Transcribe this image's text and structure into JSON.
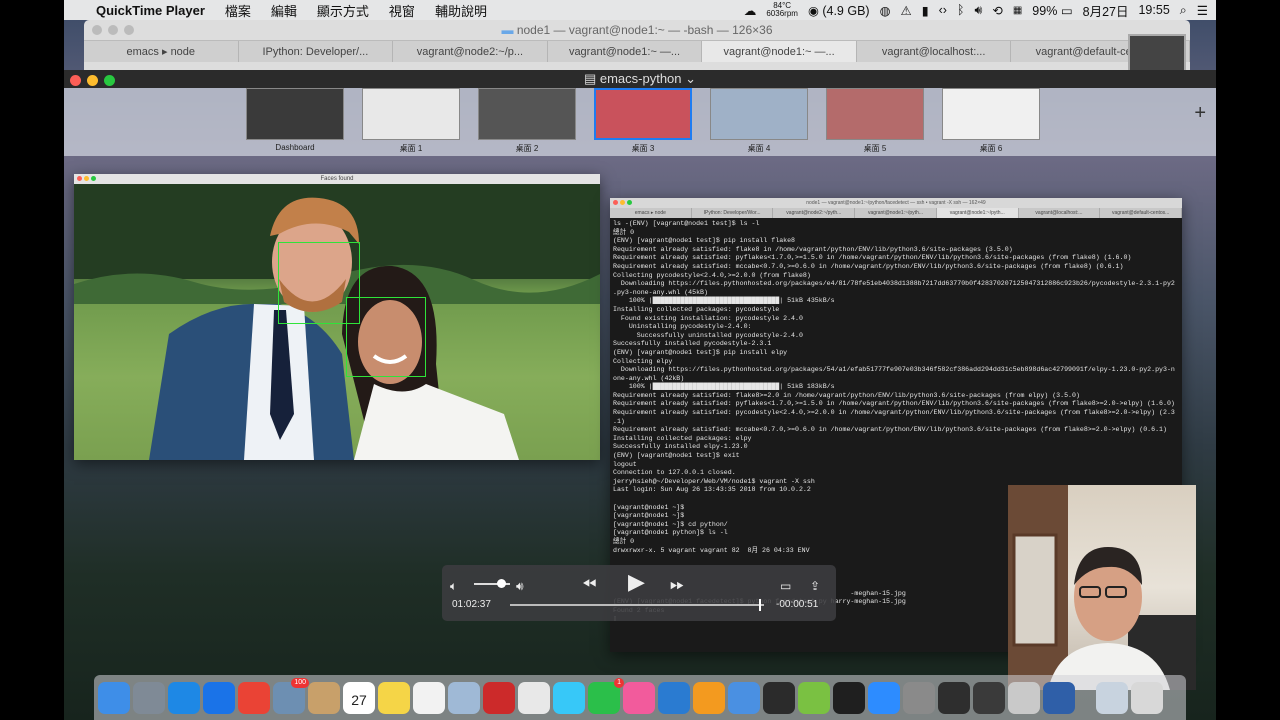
{
  "menubar": {
    "app_name": "QuickTime Player",
    "menus": [
      "檔案",
      "編輯",
      "顯示方式",
      "視窗",
      "輔助說明"
    ],
    "temperature": "84°C",
    "fan": "6036rpm",
    "memory": "(4.9 GB)",
    "battery": "99%",
    "date": "8月27日",
    "time": "19:55"
  },
  "bg_terminal": {
    "title": "node1 — vagrant@node1:~ — -bash — 126×36",
    "tabs": [
      "emacs ▸ node",
      "IPython: Developer/...",
      "vagrant@node2:~/p...",
      "vagrant@node1:~ —...",
      "vagrant@node1:~ —...",
      "vagrant@localhost:...",
      "vagrant@default-ce..."
    ],
    "active_tab": 4
  },
  "mission_control": {
    "window_title": "emacs-python",
    "spaces": [
      "Dashboard",
      "桌面 1",
      "桌面 2",
      "桌面 3",
      "桌面 4",
      "桌面 5",
      "桌面 6"
    ],
    "active_space": 3
  },
  "faces_window": {
    "title": "Faces found"
  },
  "terminal": {
    "title": "node1 — vagrant@node1:~/python/facedetect — ssh • vagrant -X ssh — 162×49",
    "tabs": [
      "emacs ▸ node",
      "IPython: Developer/Wor...",
      "vagrant@node2:~/pyth...",
      "vagrant@node1:~/pyth...",
      "vagrant@node1:~/pyth...",
      "vagrant@localhost:...",
      "vagrant@default-centos..."
    ],
    "active_tab": 4,
    "lines": [
      "ls -(ENV) [vagrant@node1 test]$ ls -l",
      "總計 0",
      "(ENV) [vagrant@node1 test]$ pip install flake8",
      "Requirement already satisfied: flake8 in /home/vagrant/python/ENV/lib/python3.6/site-packages (3.5.0)",
      "Requirement already satisfied: pyflakes<1.7.0,>=1.5.0 in /home/vagrant/python/ENV/lib/python3.6/site-packages (from flake8) (1.6.0)",
      "Requirement already satisfied: mccabe<0.7.0,>=0.6.0 in /home/vagrant/python/ENV/lib/python3.6/site-packages (from flake8) (0.6.1)",
      "Collecting pycodestyle<2.4.0,>=2.0.0 (from flake8)",
      "  Downloading https://files.pythonhosted.org/packages/e4/81/78fe51eb4038d1388b7217dd63770b0f428370207125047312886c923b26/pycodestyle-2.3.1-py2",
      ".py3-none-any.whl (45kB)",
      "    100% |████████████████████████████████| 51kB 435kB/s",
      "Installing collected packages: pycodestyle",
      "  Found existing installation: pycodestyle 2.4.0",
      "    Uninstalling pycodestyle-2.4.0:",
      "      Successfully uninstalled pycodestyle-2.4.0",
      "Successfully installed pycodestyle-2.3.1",
      "(ENV) [vagrant@node1 test]$ pip install elpy",
      "Collecting elpy",
      "  Downloading https://files.pythonhosted.org/packages/54/a1/efab51777fe907e03b346f582cf386add294dd31c5eb898d6ac42799091f/elpy-1.23.0-py2.py3-n",
      "one-any.whl (42kB)",
      "    100% |████████████████████████████████| 51kB 183kB/s",
      "Requirement already satisfied: flake8>=2.0 in /home/vagrant/python/ENV/lib/python3.6/site-packages (from elpy) (3.5.0)",
      "Requirement already satisfied: pyflakes<1.7.0,>=1.5.0 in /home/vagrant/python/ENV/lib/python3.6/site-packages (from flake8>=2.0->elpy) (1.6.0)",
      "Requirement already satisfied: pycodestyle<2.4.0,>=2.0.0 in /home/vagrant/python/ENV/lib/python3.6/site-packages (from flake8>=2.0->elpy) (2.3",
      ".1)",
      "Requirement already satisfied: mccabe<0.7.0,>=0.6.0 in /home/vagrant/python/ENV/lib/python3.6/site-packages (from flake8>=2.0->elpy) (0.6.1)",
      "Installing collected packages: elpy",
      "Successfully installed elpy-1.23.0",
      "(ENV) [vagrant@node1 test]$ exit",
      "logout",
      "Connection to 127.0.0.1 closed.",
      "jerryhsieh@~/Developer/Web/VM/node1$ vagrant -X ssh",
      "Last login: Sun Aug 26 13:43:35 2018 from 10.0.2.2",
      "",
      "[vagrant@node1 ~]$",
      "[vagrant@node1 ~]$",
      "[vagrant@node1 ~]$ cd python/",
      "[vagrant@node1 python]$ ls -l",
      "總計 0",
      "drwxrwxr-x. 5 vagrant vagrant 82  8月 26 04:33 ENV",
      "",
      "",
      "",
      "",
      "                                                            -meghan-15.jpg",
      "(ENV) [vagrant@node1 facedetect]$ python facedetect.py harry-meghan-15.jpg",
      "Found 2 faces",
      "▯"
    ]
  },
  "player": {
    "elapsed": "01:02:37",
    "remaining": "-00:00:51",
    "progress": 0.9865,
    "volume": 0.75
  },
  "dock": {
    "apps": [
      "finder-icon",
      "launchpad-icon",
      "safari-icon",
      "app-store-icon",
      "chrome-icon",
      "photo-preview-icon",
      "contacts-icon",
      "calendar-icon",
      "notes-icon",
      "reminders-icon",
      "preview-icon",
      "photo-booth-icon",
      "photos-icon",
      "messages-icon",
      "facetime-icon",
      "itunes-icon",
      "vscode-icon",
      "ibooks-icon",
      "xcode-icon",
      "obs-icon",
      "android-studio-icon",
      "terminal-icon",
      "zoom-icon",
      "system-preferences-icon",
      "activity-monitor-icon",
      "piano-icon",
      "crossover-icon",
      "virtualbox-icon",
      "folder-icon",
      "trash-icon"
    ],
    "colors": [
      "#3e8ee8",
      "#7f8a96",
      "#1e88e5",
      "#1a73e8",
      "#ea4335",
      "#6d8fb2",
      "#c8a06a",
      "#ffffff",
      "#f5d547",
      "#f2f2f2",
      "#9fb9d6",
      "#cc2a2a",
      "#e8e8e8",
      "#37c8f8",
      "#2bbf4a",
      "#f25b9c",
      "#2a7bd1",
      "#f39a1f",
      "#4a90e2",
      "#2b2b2b",
      "#7ac142",
      "#1f1f1f",
      "#2d8cff",
      "#8a8a8a",
      "#2e2e2e",
      "#3a3a3a",
      "#c9c9c9",
      "#2f5fa8",
      "#c8d3df",
      "#d8d8d8"
    ],
    "calendar_day": "27",
    "badge_photo": "100",
    "badge_facetime": "1"
  }
}
